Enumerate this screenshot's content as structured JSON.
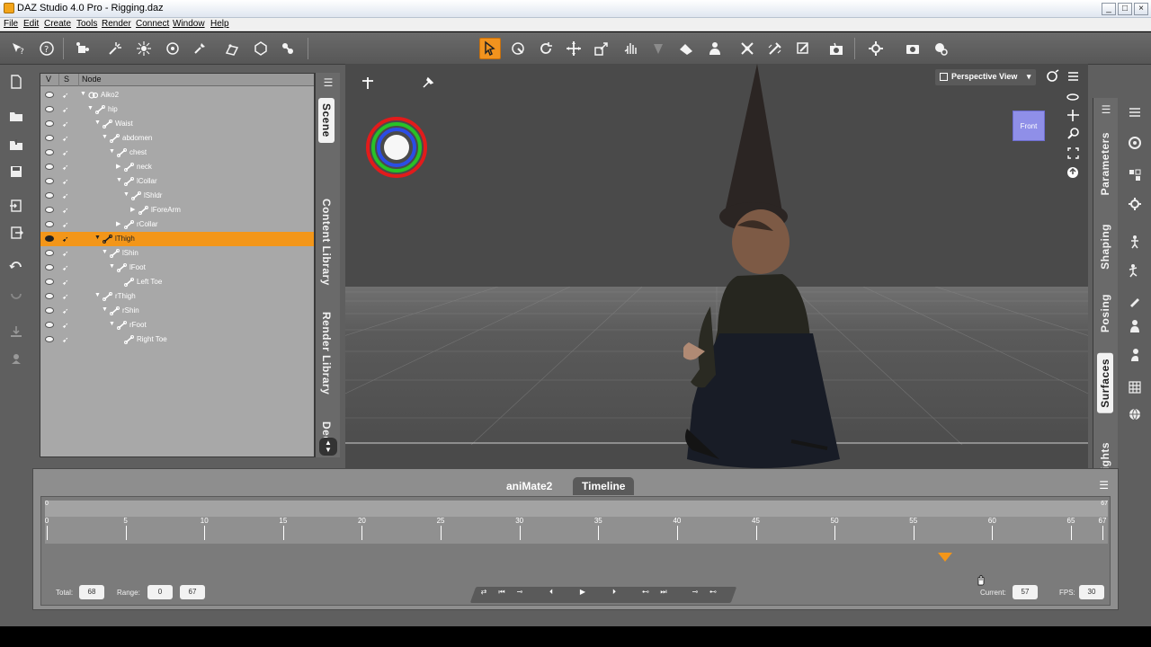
{
  "window": {
    "title": "DAZ Studio 4.0 Pro - Rigging.daz",
    "buttons": {
      "minimize": "_",
      "maximize": "□",
      "close": "×"
    }
  },
  "menu": {
    "items": [
      "File",
      "Edit",
      "Create",
      "Tools",
      "Render",
      "Connect",
      "Window",
      "Help"
    ]
  },
  "scene": {
    "headers": {
      "v": "V",
      "s": "S",
      "node": "Node"
    },
    "nodes": [
      {
        "label": "Aiko2",
        "depth": 0,
        "arrow": "▼",
        "kind": "figure",
        "selected": false
      },
      {
        "label": "hip",
        "depth": 1,
        "arrow": "▼",
        "kind": "bone",
        "selected": false
      },
      {
        "label": "Waist",
        "depth": 2,
        "arrow": "▼",
        "kind": "bone",
        "selected": false
      },
      {
        "label": "abdomen",
        "depth": 3,
        "arrow": "▼",
        "kind": "bone",
        "selected": false
      },
      {
        "label": "chest",
        "depth": 4,
        "arrow": "▼",
        "kind": "bone",
        "selected": false
      },
      {
        "label": "neck",
        "depth": 5,
        "arrow": "▶",
        "kind": "bone",
        "selected": false
      },
      {
        "label": "lCollar",
        "depth": 5,
        "arrow": "▼",
        "kind": "bone",
        "selected": false
      },
      {
        "label": "lShldr",
        "depth": 6,
        "arrow": "▼",
        "kind": "bone",
        "selected": false
      },
      {
        "label": "lForeArm",
        "depth": 7,
        "arrow": "▶",
        "kind": "bone",
        "selected": false
      },
      {
        "label": "rCollar",
        "depth": 5,
        "arrow": "▶",
        "kind": "bone",
        "selected": false
      },
      {
        "label": "lThigh",
        "depth": 2,
        "arrow": "▼",
        "kind": "bone",
        "selected": true
      },
      {
        "label": "lShin",
        "depth": 3,
        "arrow": "▼",
        "kind": "bone",
        "selected": false
      },
      {
        "label": "lFoot",
        "depth": 4,
        "arrow": "▼",
        "kind": "bone",
        "selected": false
      },
      {
        "label": "Left Toe",
        "depth": 5,
        "arrow": "",
        "kind": "bone",
        "selected": false
      },
      {
        "label": "rThigh",
        "depth": 2,
        "arrow": "▼",
        "kind": "bone",
        "selected": false
      },
      {
        "label": "rShin",
        "depth": 3,
        "arrow": "▼",
        "kind": "bone",
        "selected": false
      },
      {
        "label": "rFoot",
        "depth": 4,
        "arrow": "▼",
        "kind": "bone",
        "selected": false
      },
      {
        "label": "Right Toe",
        "depth": 5,
        "arrow": "",
        "kind": "bone",
        "selected": false
      }
    ]
  },
  "left_tabs": [
    "Scene",
    "Content Library",
    "Render Library",
    "Decimator"
  ],
  "right_tabs": [
    "Parameters",
    "Shaping",
    "Posing",
    "Surfaces",
    "Lights"
  ],
  "viewport": {
    "camera": "Perspective View",
    "cube_face": "Front"
  },
  "timeline": {
    "tabs": [
      "aniMate2",
      "Timeline"
    ],
    "active_tab": "Timeline",
    "range_start_label": "0",
    "range_end_label": "67",
    "ticks": [
      "0",
      "5",
      "10",
      "15",
      "20",
      "25",
      "30",
      "35",
      "40",
      "45",
      "50",
      "55",
      "60",
      "65",
      "67"
    ],
    "current_frame": 57,
    "total_frames": 67,
    "footer": {
      "total_label": "Total:",
      "total_value": "68",
      "range_label": "Range:",
      "range_start": "0",
      "range_end": "67",
      "current_label": "Current:",
      "current_value": "57",
      "fps_label": "FPS:",
      "fps_value": "30"
    }
  },
  "colors": {
    "accent": "#f39619",
    "panel": "#a8a8a8",
    "viewport_bg": "#4a4a4a"
  }
}
